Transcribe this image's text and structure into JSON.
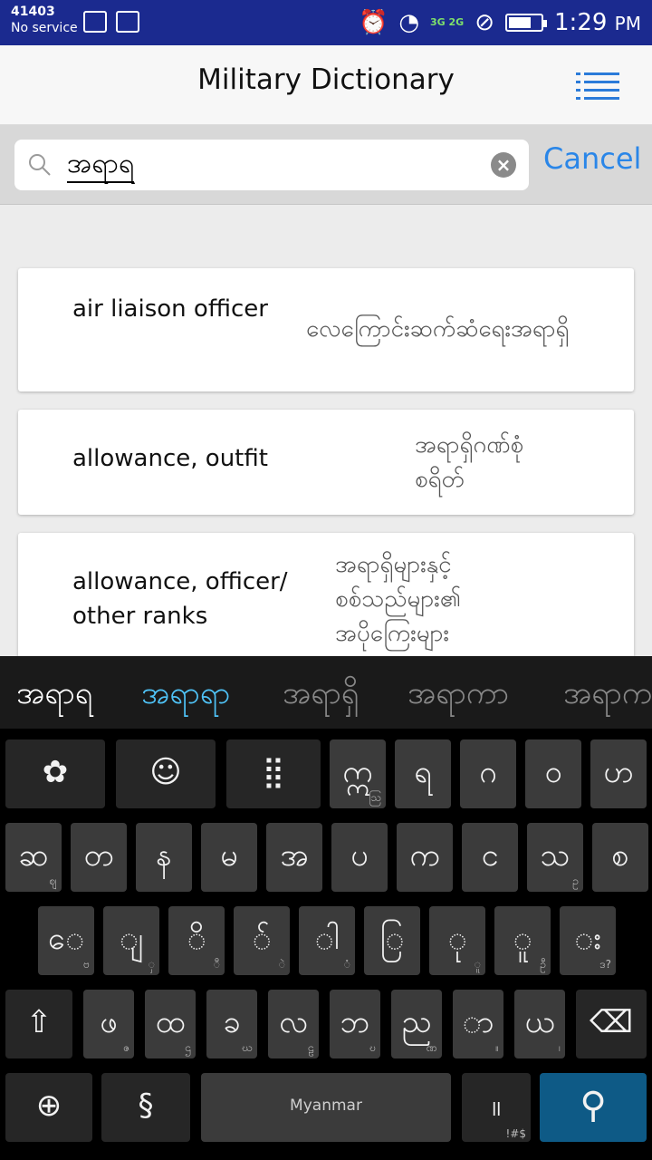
{
  "status_bar": {
    "carrier_code": "41403",
    "service": "No service",
    "network": "3G 2G",
    "time": "1:29",
    "ampm": "PM"
  },
  "header": {
    "title": "Military Dictionary"
  },
  "search": {
    "query": "အရာရ",
    "clear": "×",
    "cancel_label": "Cancel"
  },
  "results": [
    {
      "english": "air liaison officer",
      "myanmar": "လေကြောင်းဆက်ဆံရေးအရာရှိ"
    },
    {
      "english": "allowance, outfit",
      "myanmar": "အရာရှိဂဏ်စုံ\nစရိတ်"
    },
    {
      "english": "allowance, officer/ other ranks",
      "myanmar": "အရာရှိများနှင့်\nစစ်သည်များ၏\nအပိုကြေးများ"
    }
  ],
  "keyboard": {
    "suggestions": [
      "အရာရ",
      "အရာရာ",
      "အရာရှိ",
      "အရာကာ",
      "အရာက"
    ],
    "rows": [
      [
        {
          "k": "✿",
          "icon": "flower-icon"
        },
        {
          "k": "☺",
          "icon": "emoji-icon"
        },
        {
          "k": "⣿",
          "icon": "numpad-icon"
        },
        {
          "k": "ဣ",
          "s": "ဩ"
        },
        {
          "k": "ရ"
        },
        {
          "k": "ဂ"
        },
        {
          "k": "ဝ"
        },
        {
          "k": "ဟ"
        }
      ],
      [
        {
          "k": "ဆ",
          "s": "ဈ"
        },
        {
          "k": "တ"
        },
        {
          "k": "န"
        },
        {
          "k": "မ"
        },
        {
          "k": "အ"
        },
        {
          "k": "ပ"
        },
        {
          "k": "က"
        },
        {
          "k": "င"
        },
        {
          "k": "သ",
          "s": "ဥ"
        },
        {
          "k": "စ"
        }
      ],
      [
        {
          "k": "ေ",
          "s": "ဗ"
        },
        {
          "k": "ျ",
          "s": "ှ"
        },
        {
          "k": "ိ",
          "s": "ီ"
        },
        {
          "k": "်",
          "s": "ဲ"
        },
        {
          "k": "ါ",
          "s": "ံ"
        },
        {
          "k": "ြ"
        },
        {
          "k": "ု",
          "s": "ူ"
        },
        {
          "k": "ူ",
          "s": "ဦ"
        },
        {
          "k": "း",
          "s": "ဒ?"
        }
      ],
      [
        {
          "k": "⇧",
          "icon": "shift-icon"
        },
        {
          "k": "ဖ",
          "s": "ဇ"
        },
        {
          "k": "ထ",
          "s": "ဌ"
        },
        {
          "k": "ခ",
          "s": "ဃ"
        },
        {
          "k": "လ",
          "s": "ဠ"
        },
        {
          "k": "ဘ",
          "s": "ဎ"
        },
        {
          "k": "ည",
          "s": "ဏ"
        },
        {
          "k": "ာ",
          "s": "။"
        },
        {
          "k": "ယ",
          "s": "၊"
        },
        {
          "k": "⌫",
          "icon": "backspace-icon"
        }
      ],
      [
        {
          "k": "⊕",
          "icon": "globe-icon"
        },
        {
          "k": "§",
          "icon": "section-icon"
        },
        {
          "k": "Myanmar",
          "icon": "space-bar"
        },
        {
          "k": "။",
          "s": "!#$"
        },
        {
          "k": "⚲",
          "icon": "search-key-icon"
        }
      ]
    ]
  }
}
